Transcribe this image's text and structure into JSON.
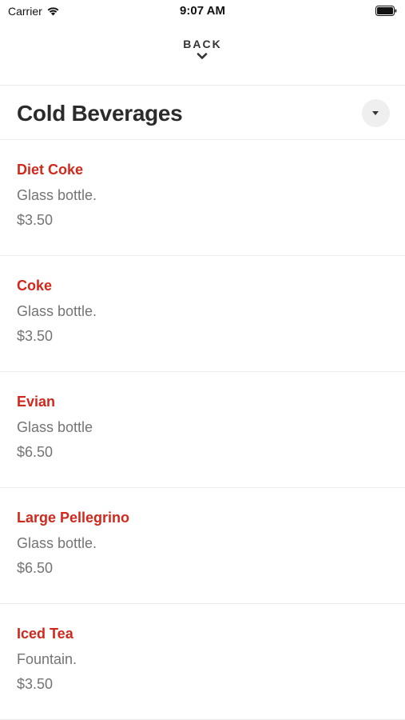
{
  "status_bar": {
    "carrier": "Carrier",
    "time": "9:07 AM"
  },
  "header": {
    "back_label": "BACK"
  },
  "section": {
    "title": "Cold Beverages"
  },
  "items": [
    {
      "name": "Diet Coke",
      "description": "Glass bottle.",
      "price": "$3.50"
    },
    {
      "name": "Coke",
      "description": "Glass bottle.",
      "price": "$3.50"
    },
    {
      "name": "Evian",
      "description": "Glass bottle",
      "price": "$6.50"
    },
    {
      "name": "Large Pellegrino",
      "description": "Glass bottle.",
      "price": "$6.50"
    },
    {
      "name": "Iced Tea",
      "description": "Fountain.",
      "price": "$3.50"
    }
  ],
  "colors": {
    "item_name": "#d0281c",
    "secondary_text": "#747474",
    "divider": "#ececec"
  },
  "icons": [
    "wifi-icon",
    "battery-icon",
    "chevron-down-icon",
    "caret-down-icon"
  ]
}
